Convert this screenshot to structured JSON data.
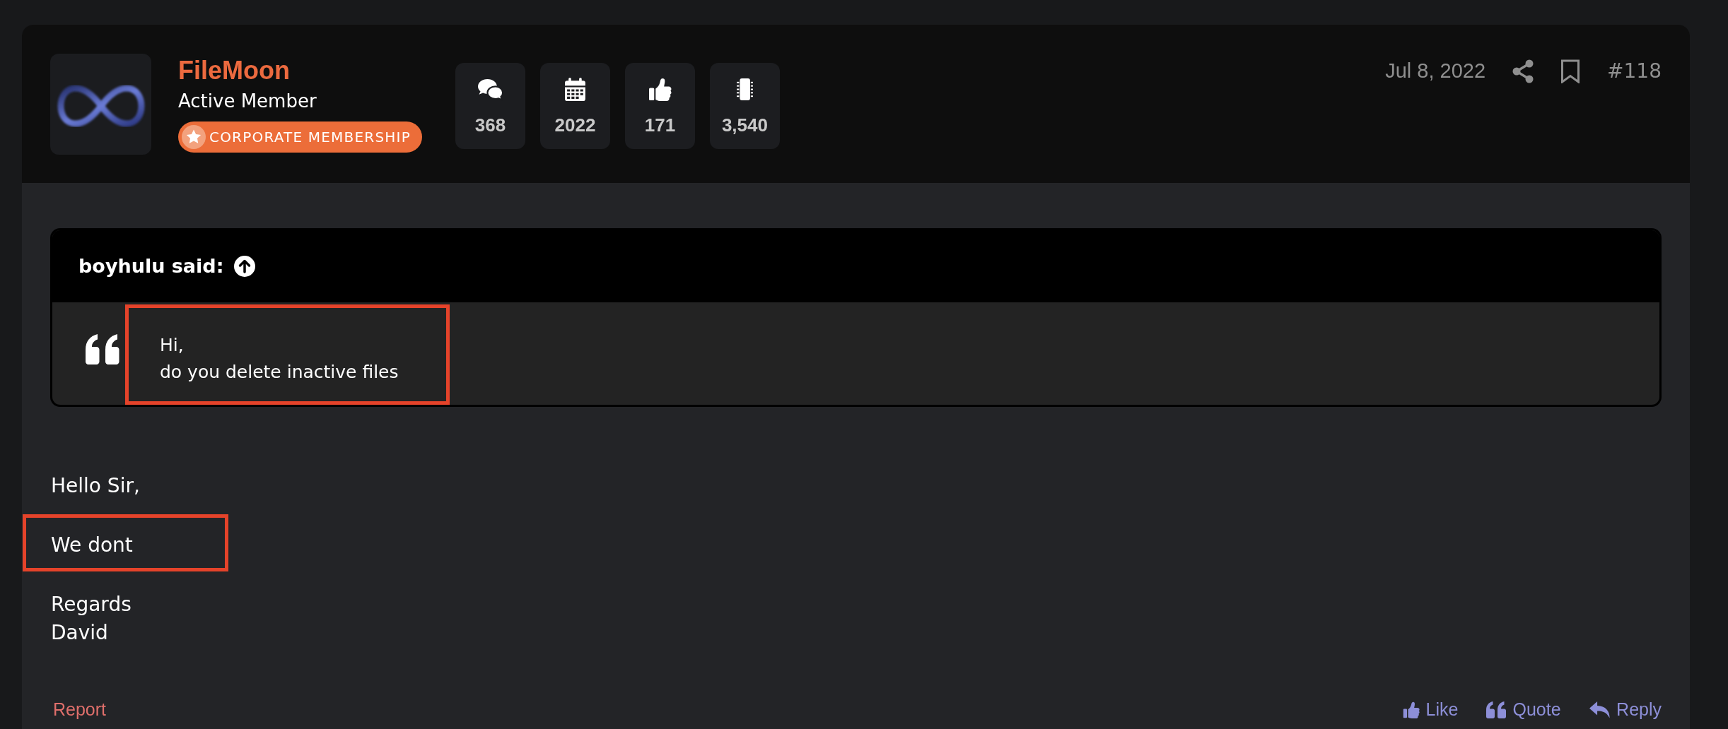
{
  "post": {
    "author": {
      "name": "FileMoon",
      "title": "Active Member",
      "badge": "CORPORATE MEMBERSHIP"
    },
    "stats": [
      {
        "kind": "chat",
        "value": "368"
      },
      {
        "kind": "calendar",
        "value": "2022"
      },
      {
        "kind": "thumb",
        "value": "171"
      },
      {
        "kind": "chip",
        "value": "3,540"
      }
    ],
    "date": "Jul 8, 2022",
    "number": "#118",
    "quote": {
      "author": "boyhulu said:",
      "lines": [
        "Hi,",
        "do you delete inactive files"
      ],
      "highlighted": true
    },
    "paragraphs": [
      {
        "lines": [
          "Hello Sir,"
        ],
        "highlighted": false
      },
      {
        "lines": [
          "We dont"
        ],
        "highlighted": true
      },
      {
        "lines": [
          "Regards",
          "David"
        ],
        "highlighted": false
      }
    ],
    "report": "Report",
    "actions": [
      {
        "kind": "like",
        "label": "Like"
      },
      {
        "kind": "quote",
        "label": "Quote"
      },
      {
        "kind": "reply",
        "label": "Reply"
      }
    ]
  }
}
